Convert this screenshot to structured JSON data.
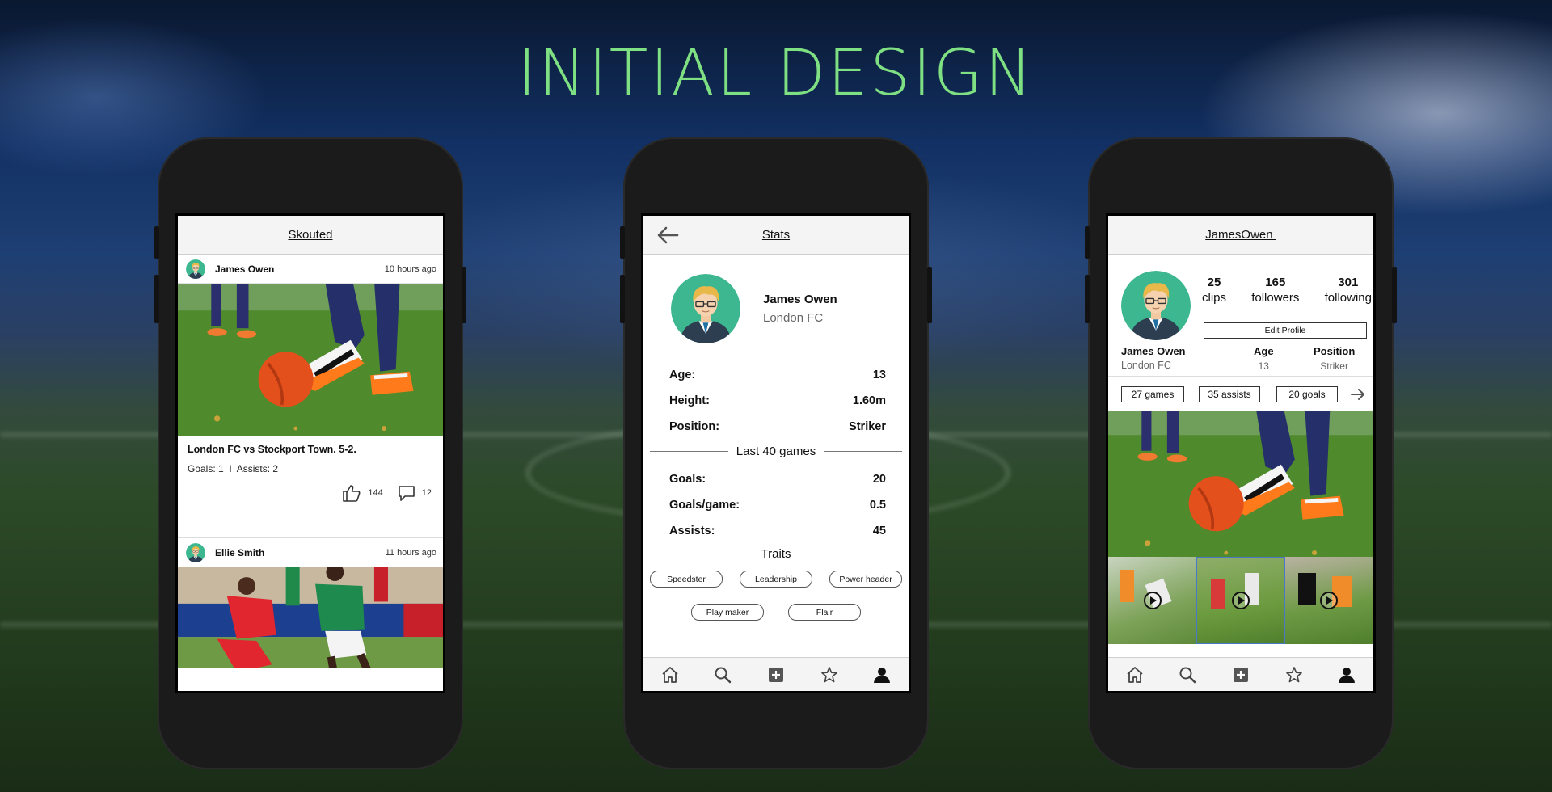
{
  "headline": "INITIAL DESIGN",
  "colors": {
    "accent": "#7ee082",
    "avatar_bg": "#3cb78f",
    "turf": "#4f8a2c"
  },
  "feed": {
    "title": "Skouted",
    "posts": [
      {
        "author": "James Owen",
        "time": "10 hours ago",
        "caption": "London FC vs Stockport Town. 5-2.",
        "stats": "Goals: 1  I  Assists: 2",
        "likes": "144",
        "comments": "12"
      },
      {
        "author": "Ellie Smith",
        "time": "11 hours ago"
      }
    ]
  },
  "stats": {
    "title": "Stats",
    "name": "James Owen",
    "club": "London FC",
    "rows": [
      {
        "label": "Age:",
        "value": "13"
      },
      {
        "label": "Height:",
        "value": "1.60m"
      },
      {
        "label": "Position:",
        "value": "Striker"
      }
    ],
    "games_header": "Last 40 games",
    "game_rows": [
      {
        "label": "Goals:",
        "value": "20"
      },
      {
        "label": "Goals/game:",
        "value": "0.5"
      },
      {
        "label": "Assists:",
        "value": "45"
      }
    ],
    "traits_header": "Traits",
    "traits": [
      "Speedster",
      "Leadership",
      "Power header",
      "Play maker",
      "Flair"
    ]
  },
  "profile": {
    "title": "JamesOwen ",
    "counts": [
      {
        "num": "25",
        "label": "clips"
      },
      {
        "num": "165",
        "label": "followers"
      },
      {
        "num": "301",
        "label": "following"
      }
    ],
    "edit_label": "Edit Profile",
    "name": "James Owen",
    "club": "London FC",
    "age_label": "Age",
    "age": "13",
    "position_label": "Position",
    "position": "Striker",
    "pills": [
      "27 games",
      "35 assists",
      "20 goals"
    ]
  },
  "nav_icons": [
    "home-icon",
    "search-icon",
    "add-icon",
    "star-icon",
    "profile-icon"
  ]
}
